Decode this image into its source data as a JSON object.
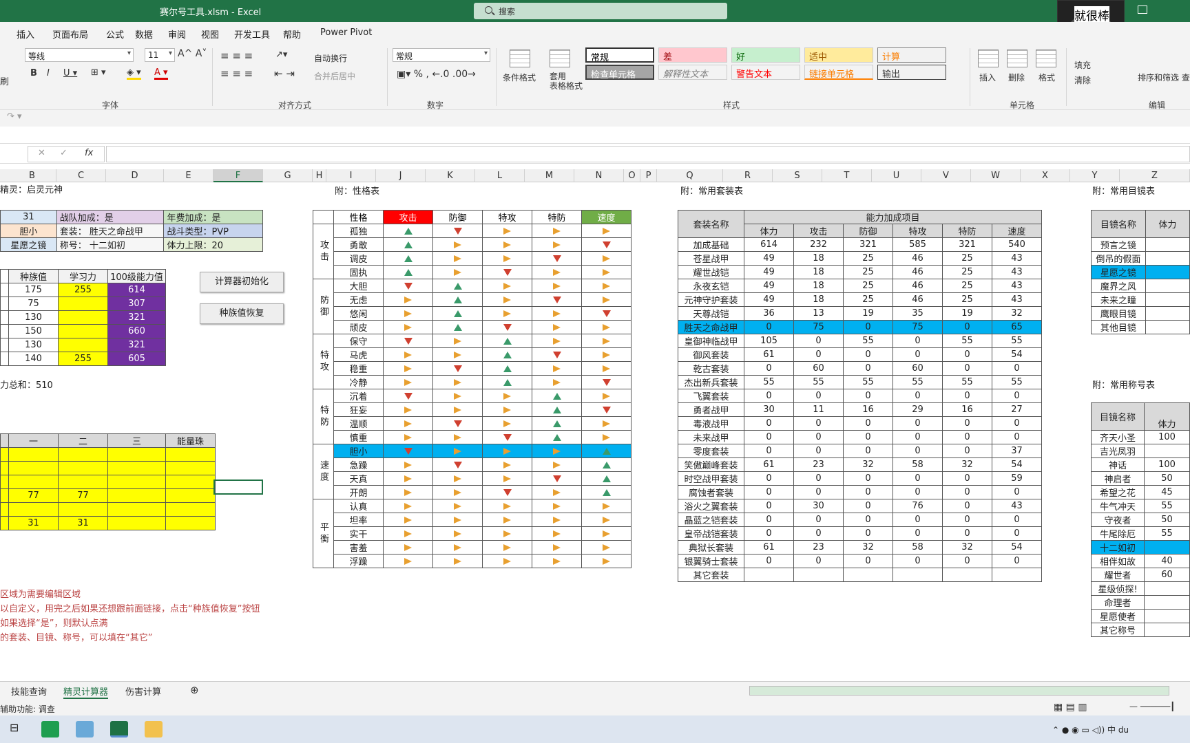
{
  "window": {
    "title": "赛尔号工具.xlsm  -  Excel",
    "search": "搜索"
  },
  "menu": [
    "插入",
    "页面布局",
    "公式",
    "数据",
    "审阅",
    "视图",
    "开发工具",
    "帮助",
    "Power Pivot"
  ],
  "ribbon": {
    "font_name": "等线",
    "font_size": "11",
    "number_format": "常规",
    "wrap_text": "自动换行",
    "merge_center": "合并后居中",
    "groups": {
      "font": "字体",
      "align": "对齐方式",
      "number": "数字",
      "styles": "样式",
      "cells": "单元格",
      "edit": "编辑"
    },
    "cond_format": "条件格式",
    "table_format": "套用\n表格格式",
    "styles": [
      "常规",
      "差",
      "好",
      "适中",
      "计算",
      "检查单元格",
      "解释性文本",
      "警告文本",
      "链接单元格",
      "输出"
    ],
    "insert": "插入",
    "delete": "删除",
    "format": "格式",
    "fill": "填充",
    "clear": "清除",
    "sort_filter": "排序和筛选 查"
  },
  "cols": [
    "B",
    "C",
    "D",
    "E",
    "F",
    "G",
    "H",
    "I",
    "J",
    "K",
    "L",
    "M",
    "N",
    "O",
    "P",
    "Q",
    "R",
    "S",
    "T",
    "U",
    "V",
    "W",
    "X",
    "Y",
    "Z"
  ],
  "sheet": {
    "elf": "精灵：启灵元神",
    "info": [
      [
        "31",
        "战队加成：是",
        "年费加成：是"
      ],
      [
        "胆小",
        "套装：  胜天之命战甲",
        "战斗类型：PVP"
      ],
      [
        "星愿之镜",
        "称号：  十二如初",
        "体力上限：20"
      ]
    ],
    "stat_headers": [
      "种族值",
      "学习力",
      "100级能力值"
    ],
    "stats": [
      [
        "175",
        "255",
        "614"
      ],
      [
        "75",
        "",
        "307"
      ],
      [
        "130",
        "",
        "321"
      ],
      [
        "150",
        "",
        "660"
      ],
      [
        "130",
        "",
        "321"
      ],
      [
        "140",
        "255",
        "605"
      ]
    ],
    "total": "力总和：510",
    "btn_init": "计算器初始化",
    "btn_restore": "种族值恢复",
    "gem_headers": [
      "一",
      "二",
      "三",
      "能量珠"
    ],
    "gems": [
      [
        "",
        "",
        "",
        ""
      ],
      [
        "",
        "",
        "",
        ""
      ],
      [
        "",
        "",
        "",
        ""
      ],
      [
        "77",
        "77",
        "",
        ""
      ],
      [
        "",
        "",
        "",
        ""
      ],
      [
        "31",
        "31",
        "",
        ""
      ]
    ],
    "notes": [
      "区域为需要编辑区域",
      "以自定义，用完之后如果还想跟前面链接，点击“种族值恢复”按钮",
      "如果选择“是”，则默认点满",
      "的套装、目镜、称号，可以填在“其它”"
    ],
    "nature_title": "附：性格表",
    "nature_headers": [
      "性格",
      "攻击",
      "防御",
      "特攻",
      "特防",
      "速度"
    ],
    "nature_groups": [
      {
        "g": "攻击",
        "rows": [
          [
            "孤独",
            "u",
            "d",
            "r",
            "r",
            "r"
          ],
          [
            "勇敢",
            "u",
            "r",
            "r",
            "r",
            "d"
          ],
          [
            "调皮",
            "u",
            "r",
            "r",
            "d",
            "r"
          ],
          [
            "固执",
            "u",
            "r",
            "d",
            "r",
            "r"
          ]
        ]
      },
      {
        "g": "防御",
        "rows": [
          [
            "大胆",
            "d",
            "u",
            "r",
            "r",
            "r"
          ],
          [
            "无虑",
            "r",
            "u",
            "r",
            "d",
            "r"
          ],
          [
            "悠闲",
            "r",
            "u",
            "r",
            "r",
            "d"
          ],
          [
            "顽皮",
            "r",
            "u",
            "d",
            "r",
            "r"
          ]
        ]
      },
      {
        "g": "特攻",
        "rows": [
          [
            "保守",
            "d",
            "r",
            "u",
            "r",
            "r"
          ],
          [
            "马虎",
            "r",
            "r",
            "u",
            "d",
            "r"
          ],
          [
            "稳重",
            "r",
            "d",
            "u",
            "r",
            "r"
          ],
          [
            "冷静",
            "r",
            "r",
            "u",
            "r",
            "d"
          ]
        ]
      },
      {
        "g": "特防",
        "rows": [
          [
            "沉着",
            "d",
            "r",
            "r",
            "u",
            "r"
          ],
          [
            "狂妄",
            "r",
            "r",
            "r",
            "u",
            "d"
          ],
          [
            "温顺",
            "r",
            "d",
            "r",
            "u",
            "r"
          ],
          [
            "慎重",
            "r",
            "r",
            "d",
            "u",
            "r"
          ]
        ]
      },
      {
        "g": "速度",
        "rows": [
          [
            "胆小",
            "d",
            "r",
            "r",
            "r",
            "u"
          ],
          [
            "急躁",
            "r",
            "d",
            "r",
            "r",
            "u"
          ],
          [
            "天真",
            "r",
            "r",
            "r",
            "d",
            "u"
          ],
          [
            "开朗",
            "r",
            "r",
            "d",
            "r",
            "u"
          ]
        ]
      },
      {
        "g": "平衡",
        "rows": [
          [
            "认真",
            "r",
            "r",
            "r",
            "r",
            "r"
          ],
          [
            "坦率",
            "r",
            "r",
            "r",
            "r",
            "r"
          ],
          [
            "实干",
            "r",
            "r",
            "r",
            "r",
            "r"
          ],
          [
            "害羞",
            "r",
            "r",
            "r",
            "r",
            "r"
          ],
          [
            "浮躁",
            "r",
            "r",
            "r",
            "r",
            "r"
          ]
        ]
      }
    ],
    "suit_title": "附：常用套装表",
    "suit_header": "套装名称",
    "suit_sub": "能力加成项目",
    "suit_cols": [
      "体力",
      "攻击",
      "防御",
      "特攻",
      "特防",
      "速度"
    ],
    "suits": [
      [
        "加成基础",
        "614",
        "232",
        "321",
        "585",
        "321",
        "540"
      ],
      [
        "苍星战甲",
        "49",
        "18",
        "25",
        "46",
        "25",
        "43"
      ],
      [
        "耀世战铠",
        "49",
        "18",
        "25",
        "46",
        "25",
        "43"
      ],
      [
        "永夜玄铠",
        "49",
        "18",
        "25",
        "46",
        "25",
        "43"
      ],
      [
        "元神守护套装",
        "49",
        "18",
        "25",
        "46",
        "25",
        "43"
      ],
      [
        "天尊战铠",
        "36",
        "13",
        "19",
        "35",
        "19",
        "32"
      ],
      [
        "胜天之命战甲",
        "0",
        "75",
        "0",
        "75",
        "0",
        "65"
      ],
      [
        "皇御神临战甲",
        "105",
        "0",
        "55",
        "0",
        "55",
        "55"
      ],
      [
        "御风套装",
        "61",
        "0",
        "0",
        "0",
        "0",
        "54"
      ],
      [
        "乾古套装",
        "0",
        "60",
        "0",
        "60",
        "0",
        "0"
      ],
      [
        "杰出新兵套装",
        "55",
        "55",
        "55",
        "55",
        "55",
        "55"
      ],
      [
        "飞翼套装",
        "0",
        "0",
        "0",
        "0",
        "0",
        "0"
      ],
      [
        "勇者战甲",
        "30",
        "11",
        "16",
        "29",
        "16",
        "27"
      ],
      [
        "毒液战甲",
        "0",
        "0",
        "0",
        "0",
        "0",
        "0"
      ],
      [
        "未来战甲",
        "0",
        "0",
        "0",
        "0",
        "0",
        "0"
      ],
      [
        "零度套装",
        "0",
        "0",
        "0",
        "0",
        "0",
        "37"
      ],
      [
        "笑傲巅峰套装",
        "61",
        "23",
        "32",
        "58",
        "32",
        "54"
      ],
      [
        "时空战甲套装",
        "0",
        "0",
        "0",
        "0",
        "0",
        "59"
      ],
      [
        "腐蚀者套装",
        "0",
        "0",
        "0",
        "0",
        "0",
        "0"
      ],
      [
        "浴火之翼套装",
        "0",
        "30",
        "0",
        "76",
        "0",
        "43"
      ],
      [
        "晶蓝之铠套装",
        "0",
        "0",
        "0",
        "0",
        "0",
        "0"
      ],
      [
        "皇帝战铠套装",
        "0",
        "0",
        "0",
        "0",
        "0",
        "0"
      ],
      [
        "典狱长套装",
        "61",
        "23",
        "32",
        "58",
        "32",
        "54"
      ],
      [
        "银翼骑士套装",
        "0",
        "0",
        "0",
        "0",
        "0",
        "0"
      ],
      [
        "其它套装",
        "",
        "",
        "",
        "",
        "",
        ""
      ]
    ],
    "eye_title": "附：常用目镜表",
    "eye_headers": [
      "目镜名称",
      "体力"
    ],
    "eyes": [
      "预言之镜",
      "倒吊的假面",
      "星愿之镜",
      "魔界之风",
      "未来之瞳",
      "鹰眼目镜",
      "其他目镜"
    ],
    "title_title": "附：常用称号表",
    "title_headers": [
      "目镜名称",
      "体力"
    ],
    "titles": [
      [
        "齐天小圣",
        "100"
      ],
      [
        "吉光凤羽",
        ""
      ],
      [
        "神话",
        "100"
      ],
      [
        "神启者",
        "50"
      ],
      [
        "希望之花",
        "45"
      ],
      [
        "牛气冲天",
        "55"
      ],
      [
        "守夜者",
        "50"
      ],
      [
        "牛尾除厄",
        "55"
      ],
      [
        "十二如初",
        ""
      ],
      [
        "相伴如故",
        "40"
      ],
      [
        "耀世者",
        "60"
      ],
      [
        "星级侦探!",
        ""
      ],
      [
        "命理者",
        ""
      ],
      [
        "星愿使者",
        ""
      ],
      [
        "其它称号",
        ""
      ]
    ]
  },
  "tabs": [
    "技能查询",
    "精灵计算器",
    "伤害计算"
  ],
  "status": "辅助功能: 调查",
  "avatar_text": "就很棒"
}
